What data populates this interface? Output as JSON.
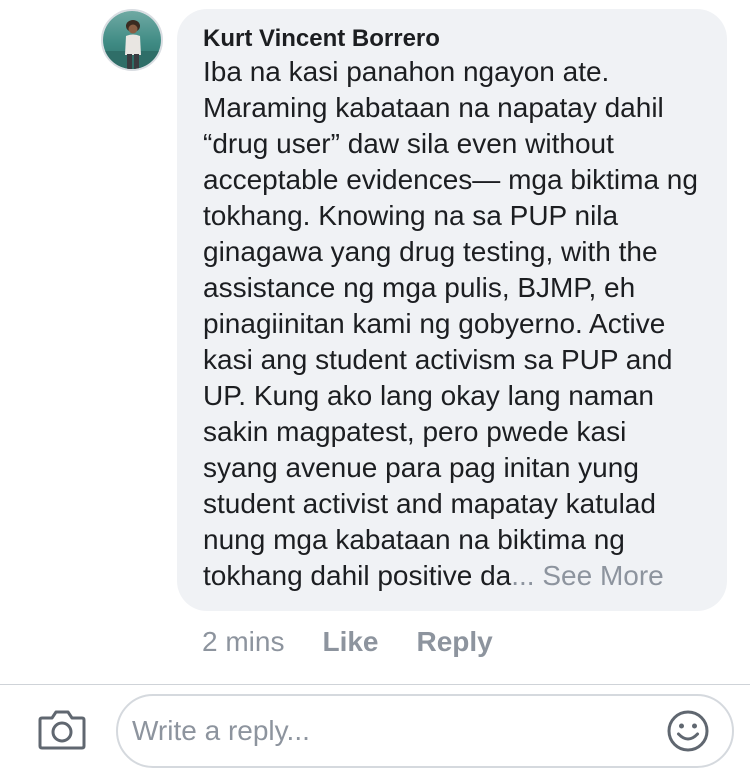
{
  "comment": {
    "author": "Kurt Vincent Borrero",
    "text": "Iba na kasi panahon ngayon ate. Maraming kabataan na napatay dahil “drug user” daw sila even without acceptable evidences— mga biktima ng tokhang. Knowing na sa PUP nila ginagawa yang drug testing, with the assistance ng mga pulis, BJMP, eh pinagiinitan kami ng gobyerno. Active kasi ang student activism sa PUP and UP. Kung ako lang okay lang naman sakin magpatest, pero pwede kasi syang avenue para pag initan yung student activist and mapatay katulad nung mga kabataan na biktima ng tokhang dahil positive da",
    "truncation": "...",
    "see_more_label": "See More",
    "timestamp": "2 mins",
    "like_label": "Like",
    "reply_label": "Reply",
    "avatar_icon": "profile-photo"
  },
  "composer": {
    "placeholder": "Write a reply...",
    "camera_icon": "camera-icon",
    "emoji_icon": "smiley-icon"
  },
  "colors": {
    "bubble": "#f0f2f5",
    "text": "#1c1e21",
    "muted": "#8d949e",
    "border": "#d5d9de"
  }
}
